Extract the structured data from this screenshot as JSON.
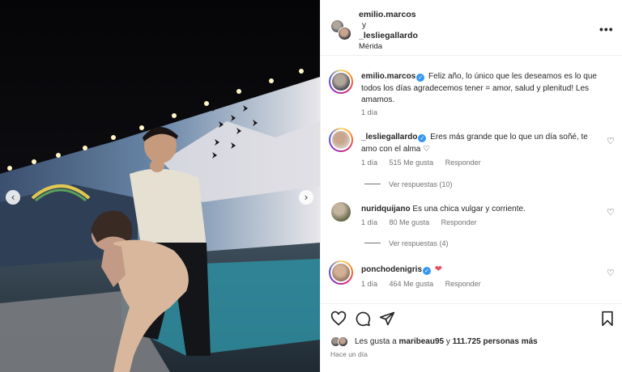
{
  "colors": {
    "accent": "#3797f0",
    "heart": "#ed4956",
    "muted": "#737373"
  },
  "photo": {
    "nav_left": "‹",
    "nav_right": "›"
  },
  "header": {
    "user1": "emilio.marcos",
    "joiner": "y",
    "user2": "_lesliegallardo",
    "location": "Mérida",
    "more": "•••"
  },
  "caption": {
    "user": "emilio.marcos",
    "text": "Feliz año, lo único que les deseamos es lo que todos los días agradecemos tener = amor, salud y plenitud! Les amamos.",
    "time": "1 día"
  },
  "comments": [
    {
      "user": "_lesliegallardo",
      "verified": true,
      "text": "Eres más grande que lo que un día soñé, te amo con el alma ♡",
      "time": "1 día",
      "likes": "515 Me gusta",
      "reply": "Responder",
      "view_replies": "Ver respuestas (10)"
    },
    {
      "user": "nuridquijano",
      "verified": false,
      "text": "Es una chica vulgar y corriente.",
      "time": "1 día",
      "likes": "80 Me gusta",
      "reply": "Responder",
      "view_replies": "Ver respuestas (4)"
    },
    {
      "user": "ponchodenigris",
      "verified": true,
      "text": "❤",
      "time": "1 día",
      "likes": "464 Me gusta",
      "reply": "Responder"
    }
  ],
  "actions": {
    "likes_prefix": "Les gusta a ",
    "likes_user": "maribeau95",
    "likes_mid": " y ",
    "likes_count": "111.725 personas más",
    "posted": "Hace un día"
  },
  "icons": [
    "heart-icon",
    "comment-icon",
    "share-icon",
    "bookmark-icon",
    "verified-icon",
    "more-icon"
  ]
}
